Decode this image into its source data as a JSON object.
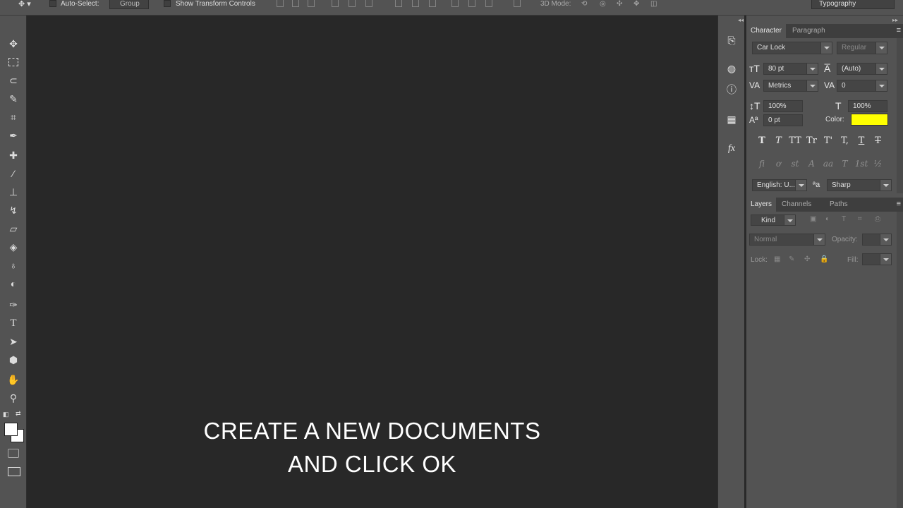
{
  "options_bar": {
    "auto_select_label": "Auto-Select:",
    "auto_select_value": "Group",
    "show_transform_label": "Show Transform Controls",
    "mode_3d_label": "3D Mode:",
    "workspace": "Typography"
  },
  "canvas": {
    "caption_line1": "CREATE A NEW DOCUMENTS",
    "caption_line2": "AND CLICK OK"
  },
  "character_panel": {
    "tabs": [
      "Character",
      "Paragraph"
    ],
    "font_family": "Car Lock",
    "font_style": "Regular",
    "font_size": "80 pt",
    "leading": "(Auto)",
    "kerning": "Metrics",
    "tracking": "0",
    "vertical_scale": "100%",
    "horizontal_scale": "100%",
    "baseline_shift": "0 pt",
    "color_label": "Color:",
    "color_value": "#ffff00",
    "type_buttons": [
      "T",
      "T",
      "TT",
      "Tr",
      "T'",
      "T,",
      "T",
      "T"
    ],
    "opentype_buttons": [
      "fi",
      "ơ",
      "st",
      "A",
      "aa",
      "T",
      "1st",
      "½"
    ],
    "language": "English: U...",
    "aa_label": "a",
    "antialias": "Sharp"
  },
  "layers_panel": {
    "tabs": [
      "Layers",
      "Channels",
      "Paths"
    ],
    "filter_kind": "Kind",
    "blend_mode": "Normal",
    "opacity_label": "Opacity:",
    "lock_label": "Lock:",
    "fill_label": "Fill:"
  },
  "tools": [
    "move-tool",
    "marquee-tool",
    "lasso-tool",
    "quick-selection-tool",
    "crop-tool",
    "eyedropper-tool",
    "healing-brush-tool",
    "brush-tool",
    "clone-stamp-tool",
    "history-brush-tool",
    "eraser-tool",
    "paint-bucket-tool",
    "blur-tool",
    "dodge-tool",
    "pen-tool",
    "type-tool",
    "path-selection-tool",
    "shape-tool",
    "hand-tool",
    "zoom-tool"
  ],
  "colors": {
    "foreground": "#ffffff",
    "background": "#ffffff",
    "ui_dark": "#282828",
    "ui_panel": "#535353"
  }
}
